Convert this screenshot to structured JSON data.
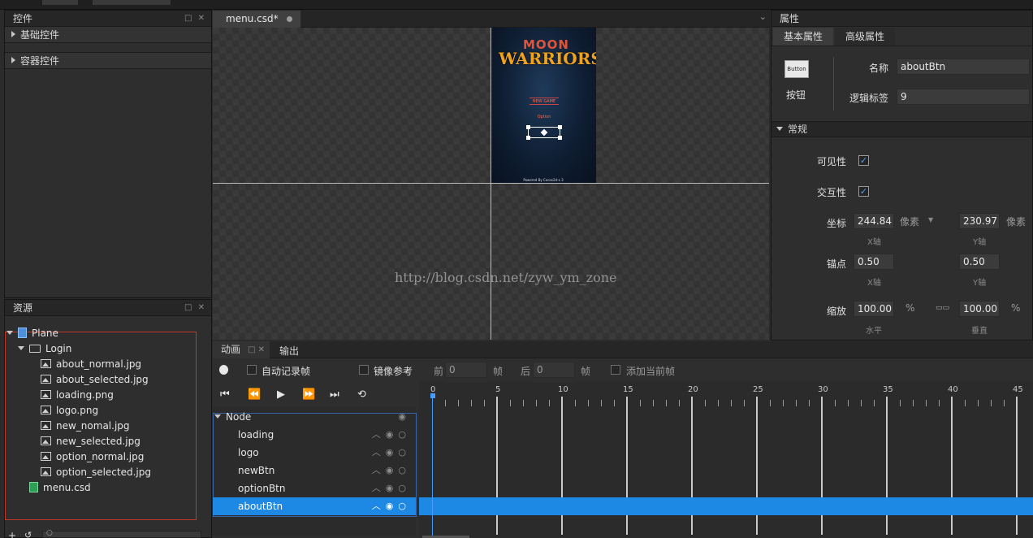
{
  "controls_panel": {
    "title": "控件",
    "groups": [
      "基础控件",
      "容器控件"
    ]
  },
  "resources_panel": {
    "title": "资源",
    "tree": {
      "root": "Plane",
      "folder": "Login",
      "files": [
        "about_normal.jpg",
        "about_selected.jpg",
        "loading.png",
        "logo.png",
        "new_nomal.jpg",
        "new_selected.jpg",
        "option_normal.jpg",
        "option_selected.jpg"
      ],
      "csd": "menu.csd"
    }
  },
  "document": {
    "tab_label": "menu.csd*",
    "watermark": "http://blog.csdn.net/zyw_ym_zone",
    "game_logo_line1": "MOON",
    "game_logo_line2": "WARRIORS",
    "menu_buttons": [
      "NEW GAME",
      "Option"
    ],
    "powered_text": "Powered By Cocos2d-x 3"
  },
  "properties_panel": {
    "title": "属性",
    "tabs": [
      "基本属性",
      "高级属性"
    ],
    "widget_icon_text": "Button",
    "widget_type": "按钮",
    "name_label": "名称",
    "name_value": "aboutBtn",
    "tag_label": "逻辑标签",
    "tag_value": "9",
    "section": "常规",
    "visibility_label": "可见性",
    "visibility_checked": true,
    "interactive_label": "交互性",
    "interactive_checked": true,
    "position_label": "坐标",
    "position_x": "244.84",
    "position_y": "230.97",
    "unit_pixel": "像素",
    "x_axis": "X轴",
    "y_axis": "Y轴",
    "anchor_label": "锚点",
    "anchor_x": "0.50",
    "anchor_y": "0.50",
    "scale_label": "缩放",
    "scale_x": "100.00",
    "scale_y": "100.00",
    "percent": "%",
    "horizontal": "水平",
    "vertical": "垂直"
  },
  "animation_panel": {
    "tabs": [
      "动画",
      "输出"
    ],
    "auto_record": "自动记录帧",
    "mirror_ref": "镜像参考",
    "before_label": "前",
    "before_value": "0",
    "frame_unit": "帧",
    "after_label": "后",
    "after_value": "0",
    "add_current": "添加当前帧",
    "root_node": "Node",
    "nodes": [
      "loading",
      "logo",
      "newBtn",
      "optionBtn",
      "aboutBtn"
    ],
    "selected_node": "aboutBtn",
    "timeline_ticks": [
      "0",
      "5",
      "10",
      "15",
      "20",
      "25",
      "30",
      "35",
      "40",
      "45"
    ]
  },
  "colors": {
    "accent": "#1e88e5",
    "selection_border": "#c0392b"
  }
}
